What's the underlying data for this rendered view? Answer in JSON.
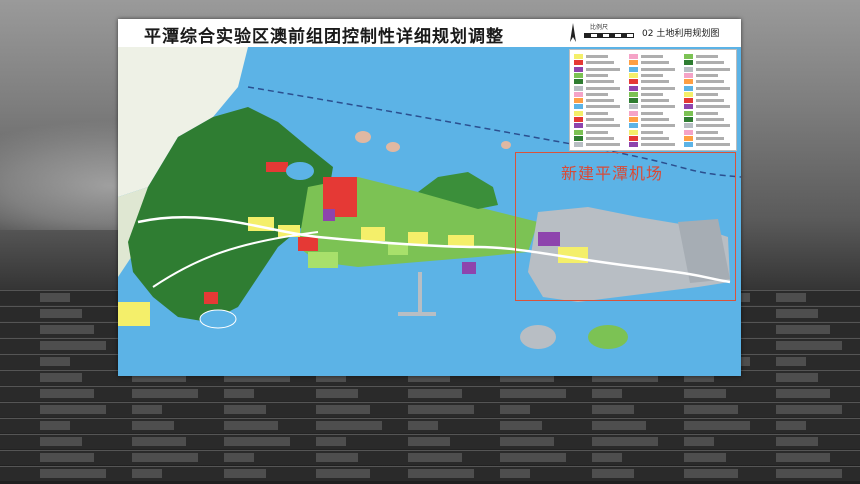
{
  "map": {
    "title": "平潭综合实验区澳前组团控制性详细规划调整",
    "sheet_number": "02 土地利用规划图",
    "scale_label": "比例尺",
    "annotation": "新建平潭机场",
    "legend_entries": 45
  },
  "colors": {
    "water": "#5cb3e6",
    "sea_light": "#b9d9ef",
    "forest": "#2f7d32",
    "green": "#7cc254",
    "residential": "#f4ef6a",
    "commercial": "#e53935",
    "industrial": "#8e44ad",
    "airport": "#b8bec4",
    "highlight_box": "#d9533a"
  }
}
